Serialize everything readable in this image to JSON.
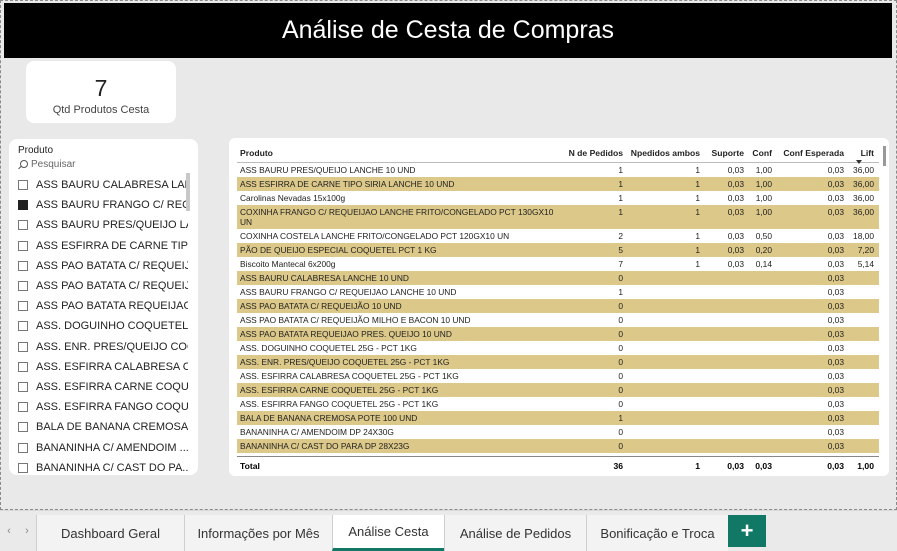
{
  "header": {
    "title": "Análise de Cesta de Compras"
  },
  "kpi": {
    "value": "7",
    "label": "Qtd Produtos Cesta"
  },
  "slicer": {
    "title": "Produto",
    "search_placeholder": "Pesquisar",
    "items": [
      {
        "label": "ASS BAURU CALABRESA LAN...",
        "checked": false
      },
      {
        "label": "ASS BAURU FRANGO C/ REQ...",
        "checked": true
      },
      {
        "label": "ASS BAURU PRES/QUEIJO LA...",
        "checked": false
      },
      {
        "label": "ASS ESFIRRA DE CARNE TIPO ...",
        "checked": false
      },
      {
        "label": "ASS PAO BATATA C/ REQUEIJÃ...",
        "checked": false
      },
      {
        "label": "ASS PAO BATATA C/ REQUEIJÃ...",
        "checked": false
      },
      {
        "label": "ASS PAO BATATA REQUEIJAO ...",
        "checked": false
      },
      {
        "label": "ASS. DOGUINHO COQUETEL ...",
        "checked": false
      },
      {
        "label": "ASS. ENR. PRES/QUEIJO COQ...",
        "checked": false
      },
      {
        "label": "ASS. ESFIRRA CALABRESA CO...",
        "checked": false
      },
      {
        "label": "ASS. ESFIRRA CARNE COQUE...",
        "checked": false
      },
      {
        "label": "ASS. ESFIRRA FANGO COQUE...",
        "checked": false
      },
      {
        "label": "BALA DE BANANA CREMOSA ...",
        "checked": false
      },
      {
        "label": "BANANINHA C/ AMENDOIM ...",
        "checked": false
      },
      {
        "label": "BANANINHA C/ CAST DO PA...",
        "checked": false
      }
    ]
  },
  "table": {
    "columns": [
      "Produto",
      "N de Pedidos",
      "Npedidos ambos",
      "Suporte",
      "Conf",
      "Conf Esperada",
      "Lift"
    ],
    "rows": [
      [
        "ASS BAURU PRES/QUEIJO LANCHE 10 UND",
        "1",
        "1",
        "0,03",
        "1,00",
        "0,03",
        "36,00"
      ],
      [
        "ASS ESFIRRA DE CARNE TIPO SIRIA LANCHE 10 UND",
        "1",
        "1",
        "0,03",
        "1,00",
        "0,03",
        "36,00"
      ],
      [
        "Carolinas Nevadas 15x100g",
        "1",
        "1",
        "0,03",
        "1,00",
        "0,03",
        "36,00"
      ],
      [
        "COXINHA FRANGO C/ REQUEIJAO LANCHE FRITO/CONGELADO PCT 130GX10 UN",
        "1",
        "1",
        "0,03",
        "1,00",
        "0,03",
        "36,00"
      ],
      [
        "COXINHA COSTELA LANCHE FRITO/CONGELADO PCT 120GX10 UN",
        "2",
        "1",
        "0,03",
        "0,50",
        "0,03",
        "18,00"
      ],
      [
        "PÃO DE QUEIJO ESPECIAL COQUETEL PCT 1 KG",
        "5",
        "1",
        "0,03",
        "0,20",
        "0,03",
        "7,20"
      ],
      [
        "Biscoito Mantecal 6x200g",
        "7",
        "1",
        "0,03",
        "0,14",
        "0,03",
        "5,14"
      ],
      [
        "ASS BAURU CALABRESA LANCHE 10 UND",
        "0",
        "",
        "",
        "",
        "0,03",
        ""
      ],
      [
        "ASS BAURU FRANGO C/ REQUEIJAO LANCHE 10 UND",
        "1",
        "",
        "",
        "",
        "0,03",
        ""
      ],
      [
        "ASS PAO BATATA C/ REQUEIJÃO 10 UND",
        "0",
        "",
        "",
        "",
        "0,03",
        ""
      ],
      [
        "ASS PAO BATATA C/ REQUEIJÃO MILHO E BACON 10 UND",
        "0",
        "",
        "",
        "",
        "0,03",
        ""
      ],
      [
        "ASS PAO BATATA REQUEIJAO PRES. QUEIJO 10 UND",
        "0",
        "",
        "",
        "",
        "0,03",
        ""
      ],
      [
        "ASS. DOGUINHO COQUETEL 25G - PCT 1KG",
        "0",
        "",
        "",
        "",
        "0,03",
        ""
      ],
      [
        "ASS. ENR. PRES/QUEIJO COQUETEL 25G - PCT 1KG",
        "0",
        "",
        "",
        "",
        "0,03",
        ""
      ],
      [
        "ASS. ESFIRRA CALABRESA COQUETEL 25G - PCT 1KG",
        "0",
        "",
        "",
        "",
        "0,03",
        ""
      ],
      [
        "ASS. ESFIRRA CARNE COQUETEL 25G - PCT 1KG",
        "0",
        "",
        "",
        "",
        "0,03",
        ""
      ],
      [
        "ASS. ESFIRRA FANGO COQUETEL 25G - PCT 1KG",
        "0",
        "",
        "",
        "",
        "0,03",
        ""
      ],
      [
        "BALA DE BANANA CREMOSA POTE 100 UND",
        "1",
        "",
        "",
        "",
        "0,03",
        ""
      ],
      [
        "BANANINHA C/ AMENDOIM DP 24X30G",
        "0",
        "",
        "",
        "",
        "0,03",
        ""
      ],
      [
        "BANANINHA C/ CAST DO PARA DP 28X23G",
        "0",
        "",
        "",
        "",
        "0,03",
        ""
      ]
    ],
    "total": [
      "Total",
      "36",
      "1",
      "0,03",
      "0,03",
      "0,03",
      "1,00"
    ]
  },
  "tabs": {
    "items": [
      "Dashboard Geral",
      "Informações por Mês",
      "Análise Cesta",
      "Análise de Pedidos",
      "Bonificação e Troca"
    ],
    "active_index": 2,
    "add_label": "+"
  },
  "colors": {
    "header_bg": "#000000",
    "row_highlight": "#dcc888",
    "accent": "#117865"
  }
}
